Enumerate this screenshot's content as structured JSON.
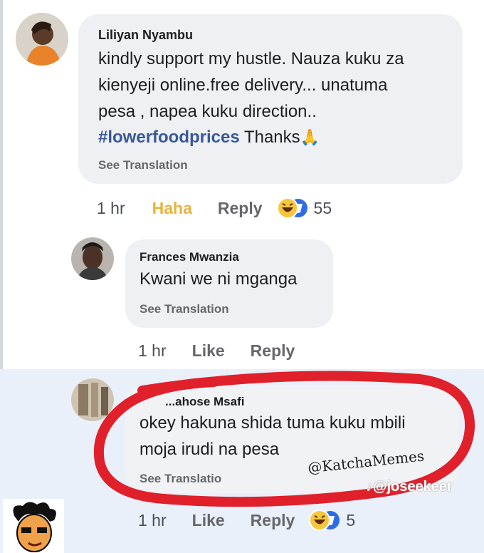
{
  "comment1": {
    "author": "Liliyan Nyambu",
    "line1": "kindly support my hustle. Nauza kuku za",
    "line2": "kienyeji online.free delivery... unatuma",
    "line3": "pesa , napea kuku direction..",
    "hashtag": "#lowerfoodprices",
    "after_hashtag": " Thanks",
    "emoji": "🙏",
    "see_translation": "See Translation",
    "time": "1 hr",
    "haha": "Haha",
    "reply": "Reply",
    "reaction_count": "55"
  },
  "comment2": {
    "author": "Frances Mwanzia",
    "text": "Kwani we ni mganga",
    "see_translation": "See Translation",
    "time": "1 hr",
    "like": "Like",
    "reply": "Reply"
  },
  "comment3": {
    "author": "...ahose Msafi",
    "line1": "okey hakuna shida tuma kuku mbili",
    "line2": "moja irudi na pesa",
    "see_translation": "See Translatio",
    "time": "1 hr",
    "like": "Like",
    "reply": "Reply",
    "reaction_count": "5"
  },
  "watermarks": {
    "katcha": "@KatchaMemes",
    "tiktok": "♪@joseekeer"
  },
  "colors": {
    "hashtag": "#385898",
    "haha_label": "#e8b43c",
    "highlight_bg": "#e9f0fa",
    "annotation_red": "#e0202a"
  }
}
